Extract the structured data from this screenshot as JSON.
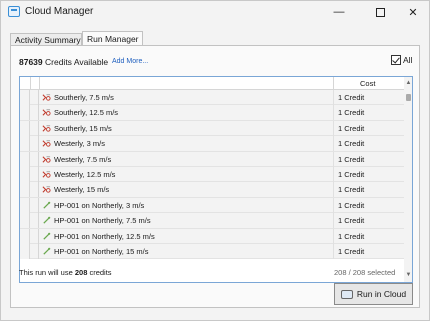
{
  "window": {
    "title": "Cloud Manager"
  },
  "tabs": [
    {
      "label": "Activity Summary",
      "active": false
    },
    {
      "label": "Run Manager",
      "active": true
    }
  ],
  "credits": {
    "count": "87639",
    "label": " Credits Available",
    "add_more": "Add More..."
  },
  "select_all": {
    "label": "All",
    "checked": true
  },
  "grid": {
    "columns": {
      "cost": "Cost"
    },
    "rows": [
      {
        "name": "Southerly, 7.5 m/s",
        "cost": "1 Credit",
        "icon": "wind-case-icon"
      },
      {
        "name": "Southerly, 12.5 m/s",
        "cost": "1 Credit",
        "icon": "wind-case-icon"
      },
      {
        "name": "Southerly, 15 m/s",
        "cost": "1 Credit",
        "icon": "wind-case-icon"
      },
      {
        "name": "Westerly, 3 m/s",
        "cost": "1 Credit",
        "icon": "wind-case-icon"
      },
      {
        "name": "Westerly, 7.5 m/s",
        "cost": "1 Credit",
        "icon": "wind-case-icon"
      },
      {
        "name": "Westerly, 12.5 m/s",
        "cost": "1 Credit",
        "icon": "wind-case-icon"
      },
      {
        "name": "Westerly, 15 m/s",
        "cost": "1 Credit",
        "icon": "wind-case-icon"
      },
      {
        "name": "HP-001 on Northerly, 3 m/s",
        "cost": "1 Credit",
        "icon": "probe-icon"
      },
      {
        "name": "HP-001 on Northerly, 7.5 m/s",
        "cost": "1 Credit",
        "icon": "probe-icon"
      },
      {
        "name": "HP-001 on Northerly, 12.5 m/s",
        "cost": "1 Credit",
        "icon": "probe-icon"
      },
      {
        "name": "HP-001 on Northerly, 15 m/s",
        "cost": "1 Credit",
        "icon": "probe-icon"
      }
    ]
  },
  "footer": {
    "usage_prefix": "This run will use ",
    "usage_count": "208",
    "usage_suffix": " credits",
    "selected": "208 / 208 selected",
    "run_label": "Run in Cloud"
  },
  "colors": {
    "accent": "#1f5fbf",
    "grid_border": "#7aa6d6",
    "wind_icon": "#c0392b",
    "probe_icon": "#6aa84f"
  }
}
